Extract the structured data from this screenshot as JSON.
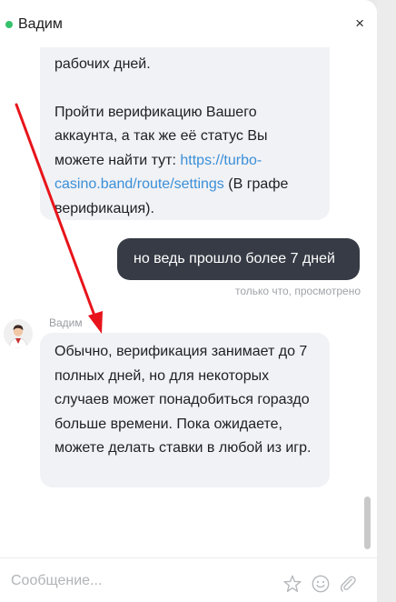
{
  "header": {
    "title": "Вадим",
    "close_glyph": "×"
  },
  "messages": {
    "incoming_1": {
      "line_top": "рабочих дней.",
      "para2_text": "Пройти верификацию Вашего аккаунта, а так же её статус Вы можете найти тут: ",
      "link_text": "https://turbo-casino.band/route/settings",
      "para2_tail": " (В графе верификация)."
    },
    "outgoing": {
      "text": "но ведь прошло более 7 дней",
      "status": "только что, просмотрено"
    },
    "incoming_2": {
      "sender": "Вадим",
      "text": "Обычно, верификация занимает до 7 полных дней, но для некоторых случаев может понадобиться гораздо больше времени. Пока ожидаете, можете делать ставки в любой из игр."
    }
  },
  "composer": {
    "placeholder": "Сообщение..."
  },
  "icons": {
    "online": "online-dot-icon",
    "close": "close-icon",
    "star": "star-icon",
    "smile": "smile-icon",
    "clip": "paperclip-icon",
    "avatar": "avatar-icon",
    "annotation": "arrow-icon"
  },
  "colors": {
    "online": "#35c26b",
    "link": "#3a8fd8",
    "outgoing_bubble": "#363b45",
    "incoming_bubble": "#f1f2f5",
    "annotation_arrow": "#e8141b"
  }
}
